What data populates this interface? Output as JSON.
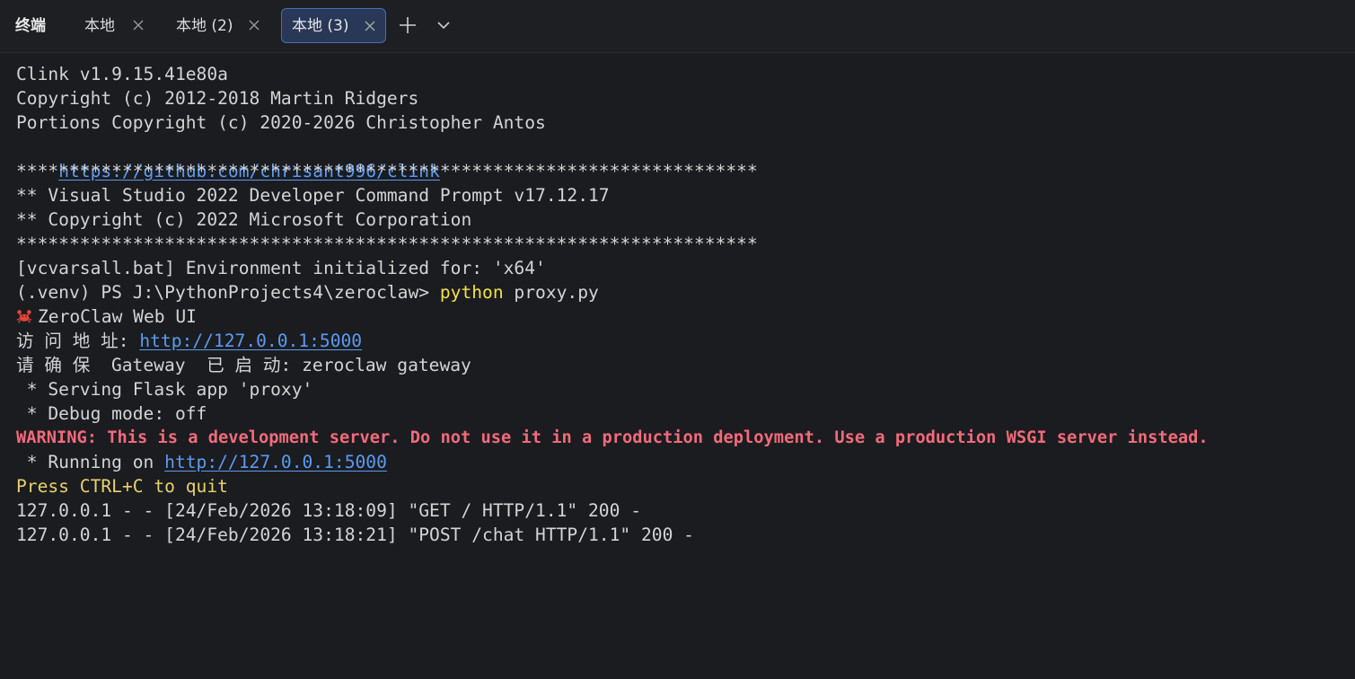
{
  "app": {
    "title": "终端"
  },
  "tabs": [
    {
      "label": "本地",
      "active": false
    },
    {
      "label": "本地 (2)",
      "active": false
    },
    {
      "label": "本地 (3)",
      "active": true
    }
  ],
  "colors": {
    "link": "#5b9bf2",
    "command": "#f5e148",
    "warning": "#f26b7a",
    "active_tab_bg": "#283856",
    "active_tab_border": "#4a6cb5"
  },
  "terminal": {
    "l1": "Clink v1.9.15.41e80a",
    "l2": "Copyright (c) 2012-2018 Martin Ridgers",
    "l3": "Portions Copyright (c) 2020-2026 Christopher Antos",
    "l4_link": "https://github.com/chrisant996/clink",
    "l5": "**********************************************************************",
    "l6": "** Visual Studio 2022 Developer Command Prompt v17.12.17",
    "l7": "** Copyright (c) 2022 Microsoft Corporation",
    "l8": "**********************************************************************",
    "l9": "[vcvarsall.bat] Environment initialized for: 'x64'",
    "l10_prompt": "(.venv) PS J:\\PythonProjects4\\zeroclaw> ",
    "l10_cmd": "python",
    "l10_args": " proxy.py",
    "l11": "ZeroClaw Web UI",
    "l12_label": "访 问 地 址: ",
    "l12_link": "http://127.0.0.1:5000",
    "l13": "请 确 保  Gateway  已 启 动: zeroclaw gateway",
    "l14": " * Serving Flask app 'proxy'",
    "l15": " * Debug mode: off",
    "l16": "WARNING: This is a development server. Do not use it in a production deployment. Use a production WSGI server instead.",
    "l17_prefix": " * Running on ",
    "l17_link": "http://127.0.0.1:5000",
    "l18": "Press CTRL+C to quit",
    "l19": "127.0.0.1 - - [24/Feb/2026 13:18:09] \"GET / HTTP/1.1\" 200 -",
    "l20": "127.0.0.1 - - [24/Feb/2026 13:18:21] \"POST /chat HTTP/1.1\" 200 -"
  }
}
